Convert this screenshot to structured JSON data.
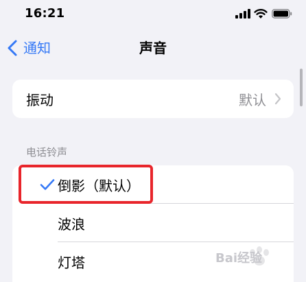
{
  "status_bar": {
    "time": "16:21"
  },
  "nav": {
    "back_label": "通知",
    "title": "声音"
  },
  "vibration": {
    "label": "振动",
    "value": "默认"
  },
  "ringtones": {
    "header": "电话铃声",
    "items": [
      {
        "label": "倒影（默认）",
        "selected": true
      },
      {
        "label": "波浪",
        "selected": false
      },
      {
        "label": "灯塔",
        "selected": false
      }
    ]
  },
  "colors": {
    "accent": "#3478f6",
    "highlight": "#e8252b",
    "background": "#f2f2f7",
    "secondary_text": "#8e8e93"
  },
  "watermark": {
    "text": "Bai经验"
  }
}
